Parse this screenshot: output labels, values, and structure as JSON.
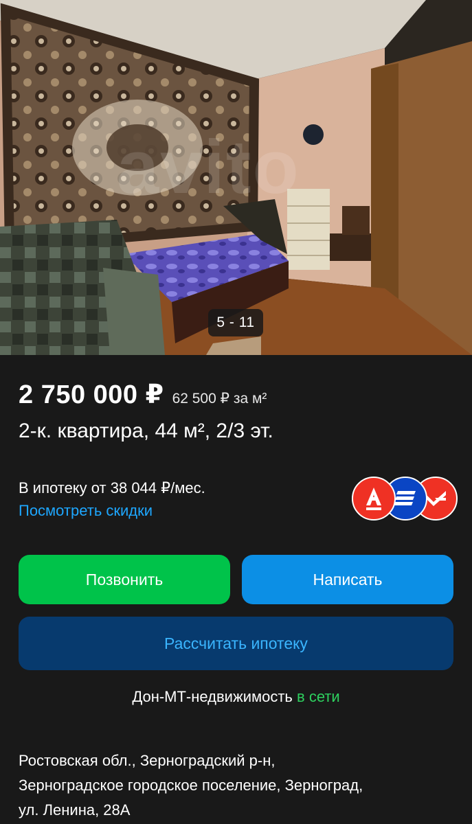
{
  "gallery": {
    "counter": "5 - 11",
    "watermark": "avito"
  },
  "listing": {
    "price": "2 750 000 ₽",
    "price_per_m2": "62 500 ₽ за м²",
    "title": "2-к. квартира, 44 м², 2/3 эт."
  },
  "mortgage": {
    "text": "В ипотеку от 38 044 ₽/мес.",
    "discounts_link": "Посмотреть скидки",
    "banks": [
      "alfa-bank-icon",
      "vtb-icon",
      "pochta-bank-icon"
    ]
  },
  "actions": {
    "call_label": "Позвонить",
    "write_label": "Написать",
    "mortgage_label": "Рассчитать ипотеку"
  },
  "seller": {
    "name": "Дон-МТ-недвижимость",
    "status": "в сети"
  },
  "address": {
    "lines": [
      "Ростовская обл., Зерноградский р-н,",
      "Зерноградское городское поселение, Зерноград,",
      "ул. Ленина, 28А"
    ]
  },
  "colors": {
    "background": "#191919",
    "call_button": "#00c34a",
    "write_button": "#0c8fe5",
    "mortgage_button": "#073a6e",
    "link": "#1ea7ff",
    "online": "#2ed05f"
  }
}
